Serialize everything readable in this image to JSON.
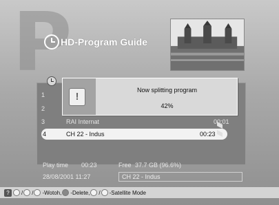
{
  "watermark_letter": "P",
  "header": {
    "title": "HD-Program Guide",
    "icon": "clock-icon"
  },
  "thumbnail": {
    "description_icon": "tv-thumbnail"
  },
  "programs": [
    {
      "num": "1",
      "name": "",
      "time": ""
    },
    {
      "num": "2",
      "name": "",
      "time": ""
    },
    {
      "num": "3",
      "name": "RAI Internat",
      "time": "00:01"
    },
    {
      "num": "4",
      "name": "CH 22 - Indus",
      "time": "00:23"
    }
  ],
  "dialog": {
    "message": "Now splitting program",
    "percent": "42%",
    "icon": "warning-icon"
  },
  "status": {
    "play_label": "Play time",
    "play_value": "00:23",
    "free_label": "Free",
    "free_value": "37.7 GB (96.6%)",
    "datetime": "28/08/2001 11:27",
    "current_channel": "CH 22 - Indus"
  },
  "footer": {
    "help": "?",
    "wotoh": "-Wotoh,",
    "delete": "-Delete,",
    "satellite": "-Satellite Mode",
    "sep": "/"
  }
}
